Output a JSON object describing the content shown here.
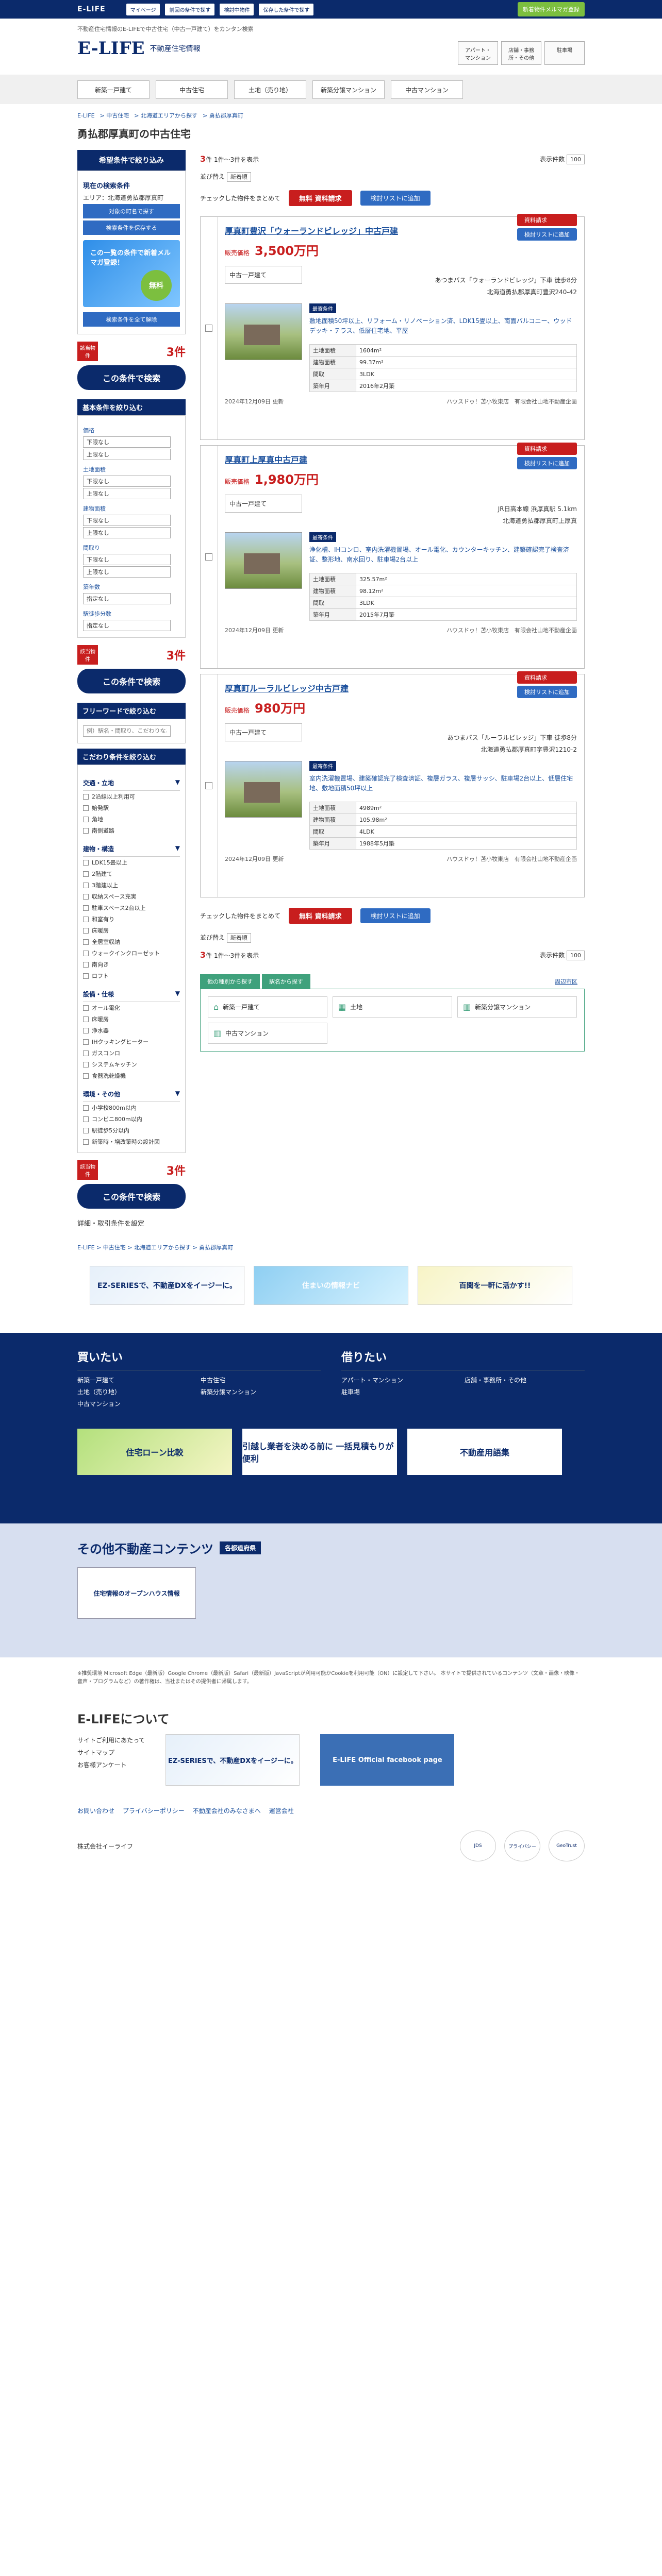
{
  "topbar": {
    "logo": "E-LIFE",
    "links": [
      "マイページ",
      "前回の条件で探す",
      "検討中物件",
      "保存した条件で探す"
    ],
    "cta": "新着物件メルマガ登録"
  },
  "header": {
    "desc": "不動産住宅情報のE-LIFEで中古住宅（中古一戸建て）をカンタン検索",
    "logo": "E-LIFE",
    "sub": "不動産住宅情報",
    "links": [
      "アパート・マンション",
      "店舗・事務所・その他",
      "駐車場"
    ]
  },
  "gnav": [
    "新築一戸建て",
    "中古住宅",
    "土地（売り地）",
    "新築分譲マンション",
    "中古マンション"
  ],
  "breadcrumb": [
    "E-LIFE",
    "中古住宅",
    "北海道エリアから探す",
    "勇払郡厚真町"
  ],
  "page_title": "勇払郡厚真町の中古住宅",
  "sidebar": {
    "head": "希望条件で絞り込み",
    "current": "現在の検索条件",
    "area_label": "エリア：北海道勇払郡厚真町",
    "btn_area": "対象の町名で探す",
    "btn_save": "検索条件を保存する",
    "banner": "この一覧の条件で新着メルマガ登録！",
    "banner_circle": "無料",
    "btn_clear": "検索条件を全て解除",
    "count_tag": "該当物件",
    "count": "3件",
    "search_btn": "この条件で検索",
    "basic": "基本条件を絞り込む",
    "conds": [
      {
        "label": "価格",
        "a": "下限なし",
        "b": "上限なし"
      },
      {
        "label": "土地面積",
        "a": "下限なし",
        "b": "上限なし"
      },
      {
        "label": "建物面積",
        "a": "下限なし",
        "b": "上限なし"
      },
      {
        "label": "間取り",
        "a": "下限なし",
        "b": "上限なし"
      },
      {
        "label": "築年数",
        "a": "指定なし",
        "b": ""
      },
      {
        "label": "駅徒歩分数",
        "a": "指定なし",
        "b": ""
      }
    ],
    "free_word": "フリーワードで絞り込む",
    "free_placeholder": "例）駅名・間取り、こだわりなど",
    "kodawari": "こだわり条件を絞り込む",
    "cat1": "交通・立地",
    "cat1_items": [
      "2沿線以上利用可",
      "始発駅",
      "角地",
      "南側道路"
    ],
    "cat2": "建物・構造",
    "cat2_items": [
      "LDK15畳以上",
      "2階建て",
      "3階建以上",
      "収納スペース充実",
      "駐車スペース2台以上",
      "和室有り",
      "床暖房",
      "全居室収納",
      "ウォークインクローゼット",
      "南向き",
      "ロフト"
    ],
    "cat3": "設備・仕様",
    "cat3_items": [
      "オール電化",
      "床暖房",
      "浄水器",
      "IHクッキングヒーター",
      "ガスコンロ",
      "システムキッチン",
      "食器洗乾燥機"
    ],
    "cat4": "環境・その他",
    "cat4_items": [
      "小学校800m以内",
      "コンビニ800m以内",
      "駅徒歩5分以内",
      "新築時・増改築時の設計図"
    ],
    "bottom_btn": "詳細・取引条件を設定"
  },
  "main": {
    "total": "3",
    "range": "1件～3件を表示",
    "sort_label": "並び替え",
    "sort_value": "新着順",
    "per_page_label": "表示件数",
    "per_page": "100",
    "check_all": "チェックした物件をまとめて",
    "req_btn": "資料請求",
    "fav_btn": "検討リストに追加",
    "free": "無料",
    "listings": [
      {
        "title": "厚真町豊沢「ウォーランドビレッジ」中古戸建",
        "price_label": "販売価格",
        "price": "3,500万円",
        "type": "中古一戸建て",
        "access": "あつまバス「ウォーランドビレッジ」下車 徒歩8分",
        "address": "北海道勇払郡厚真町豊沢240-42",
        "feat_tag": "最寄条件",
        "features": "敷地面積50坪以上、リフォーム・リノベーション済、LDK15畳以上、南面バルコニー、ウッドデッキ・テラス、低層住宅地、平屋",
        "rows": [
          [
            "土地面積",
            "1604m²"
          ],
          [
            "建物面積",
            "99.37m²"
          ],
          [
            "間取",
            "3LDK"
          ],
          [
            "築年月",
            "2016年2月築"
          ]
        ],
        "date": "2024年12月09日 更新",
        "company": "ハウスドゥ！苫小牧東店　有限会社山地不動産企画"
      },
      {
        "title": "厚真町上厚真中古戸建",
        "price_label": "販売価格",
        "price": "1,980万円",
        "type": "中古一戸建て",
        "access": "JR日高本線 浜厚真駅 5.1km",
        "address": "北海道勇払郡厚真町上厚真",
        "feat_tag": "最寄条件",
        "features": "浄化槽、IHコンロ、室内洗濯機置場、オール電化、カウンターキッチン、建築確認完了検査済証、整形地、南水回り、駐車場2台以上",
        "rows": [
          [
            "土地面積",
            "325.57m²"
          ],
          [
            "建物面積",
            "98.12m²"
          ],
          [
            "間取",
            "3LDK"
          ],
          [
            "築年月",
            "2015年7月築"
          ]
        ],
        "date": "2024年12月09日 更新",
        "company": "ハウスドゥ！苫小牧東店　有限会社山地不動産企画"
      },
      {
        "title": "厚真町ルーラルビレッジ中古戸建",
        "price_label": "販売価格",
        "price": "980万円",
        "type": "中古一戸建て",
        "access": "あつまバス「ルーラルビレッジ」下車 徒歩8分",
        "address": "北海道勇払郡厚真町字豊沢1210-2",
        "feat_tag": "最寄条件",
        "features": "室内洗濯機置場、建築確認完了検査済証、複層ガラス、複層サッシ、駐車場2台以上、低層住宅地、敷地面積50坪以上",
        "rows": [
          [
            "土地面積",
            "4989m²"
          ],
          [
            "建物面積",
            "105.98m²"
          ],
          [
            "間取",
            "4LDK"
          ],
          [
            "築年月",
            "1988年5月築"
          ]
        ],
        "date": "2024年12月09日 更新",
        "company": "ハウスドゥ！苫小牧東店　有限会社山地不動産企画"
      }
    ],
    "tabs": [
      "他の種別から探す",
      "駅名から探す"
    ],
    "tab_right": "周辺市区",
    "other_links": [
      "新築一戸建て",
      "土地",
      "新築分譲マンション",
      "中古マンション"
    ]
  },
  "breadcrumb2": [
    "E-LIFE",
    "中古住宅",
    "北海道エリアから探す",
    "勇払郡厚真町"
  ],
  "banners": [
    "EZ-SERIESで、不動産DXをイージーに。",
    "住まいの情報ナビ",
    "百聞を一軒に活かす!!"
  ],
  "footer": {
    "buy": "買いたい",
    "buy_links": [
      "新築一戸建て",
      "中古住宅",
      "土地（売り地）",
      "新築分譲マンション",
      "中古マンション"
    ],
    "rent": "借りたい",
    "rent_links": [
      "アパート・マンション",
      "店舗・事務所・その他",
      "駐車場"
    ],
    "banners": [
      "住宅ローン比較",
      "引越し業者を決める前に 一括見積もりが便利",
      "不動産用語集"
    ]
  },
  "other_content": {
    "title": "その他不動産コンテンツ",
    "tag": "各都道府県",
    "card": "住宅情報のオープンハウス情報"
  },
  "notes": "※推奨環境\nMicrosoft Edge（最新版）Google Chrome（最新版）Safari（最新版）JavaScriptが利用可能かCookieを利用可能（ON）に設定して下さい。\n本サイトで提供されているコンテンツ（文章・画像・映像・音声・プログラムなど）の著作権は、当社またはその提供者に帰属します。",
  "about": {
    "title": "E-LIFEについて",
    "links": [
      "サイトご利用にあたって",
      "サイトマップ",
      "お客様アンケート"
    ],
    "banner": "EZ-SERIESで、不動産DXをイージーに。",
    "facebook": "E-LIFE Official facebook page"
  },
  "bottom_links": [
    "お問い合わせ",
    "プライバシーポリシー",
    "不動産会社のみなさまへ",
    "運営会社"
  ],
  "corp": "株式会社イーライフ",
  "seals": [
    "JDS",
    "プライバシー",
    "GeoTrust"
  ]
}
